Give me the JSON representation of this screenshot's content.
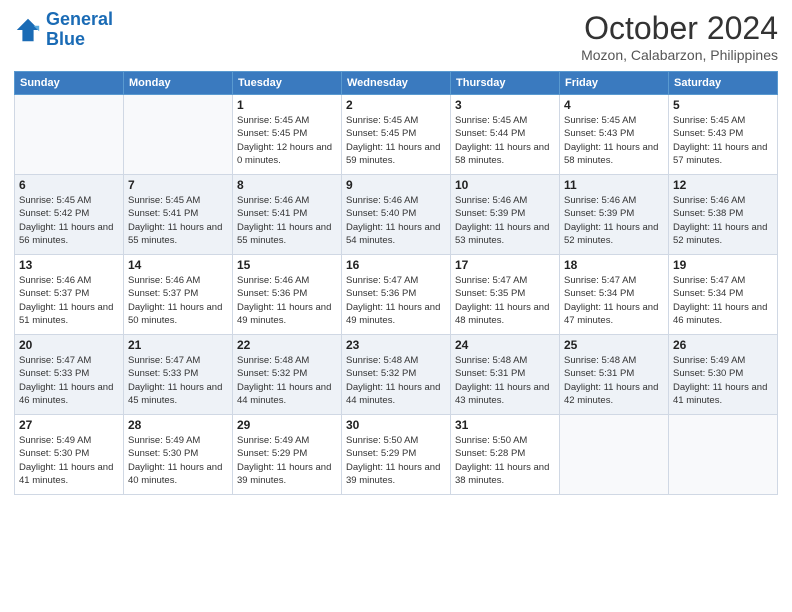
{
  "logo": {
    "line1": "General",
    "line2": "Blue"
  },
  "title": "October 2024",
  "subtitle": "Mozon, Calabarzon, Philippines",
  "days_of_week": [
    "Sunday",
    "Monday",
    "Tuesday",
    "Wednesday",
    "Thursday",
    "Friday",
    "Saturday"
  ],
  "weeks": [
    [
      {
        "day": "",
        "info": ""
      },
      {
        "day": "",
        "info": ""
      },
      {
        "day": "1",
        "info": "Sunrise: 5:45 AM\nSunset: 5:45 PM\nDaylight: 12 hours and 0 minutes."
      },
      {
        "day": "2",
        "info": "Sunrise: 5:45 AM\nSunset: 5:45 PM\nDaylight: 11 hours and 59 minutes."
      },
      {
        "day": "3",
        "info": "Sunrise: 5:45 AM\nSunset: 5:44 PM\nDaylight: 11 hours and 58 minutes."
      },
      {
        "day": "4",
        "info": "Sunrise: 5:45 AM\nSunset: 5:43 PM\nDaylight: 11 hours and 58 minutes."
      },
      {
        "day": "5",
        "info": "Sunrise: 5:45 AM\nSunset: 5:43 PM\nDaylight: 11 hours and 57 minutes."
      }
    ],
    [
      {
        "day": "6",
        "info": "Sunrise: 5:45 AM\nSunset: 5:42 PM\nDaylight: 11 hours and 56 minutes."
      },
      {
        "day": "7",
        "info": "Sunrise: 5:45 AM\nSunset: 5:41 PM\nDaylight: 11 hours and 55 minutes."
      },
      {
        "day": "8",
        "info": "Sunrise: 5:46 AM\nSunset: 5:41 PM\nDaylight: 11 hours and 55 minutes."
      },
      {
        "day": "9",
        "info": "Sunrise: 5:46 AM\nSunset: 5:40 PM\nDaylight: 11 hours and 54 minutes."
      },
      {
        "day": "10",
        "info": "Sunrise: 5:46 AM\nSunset: 5:39 PM\nDaylight: 11 hours and 53 minutes."
      },
      {
        "day": "11",
        "info": "Sunrise: 5:46 AM\nSunset: 5:39 PM\nDaylight: 11 hours and 52 minutes."
      },
      {
        "day": "12",
        "info": "Sunrise: 5:46 AM\nSunset: 5:38 PM\nDaylight: 11 hours and 52 minutes."
      }
    ],
    [
      {
        "day": "13",
        "info": "Sunrise: 5:46 AM\nSunset: 5:37 PM\nDaylight: 11 hours and 51 minutes."
      },
      {
        "day": "14",
        "info": "Sunrise: 5:46 AM\nSunset: 5:37 PM\nDaylight: 11 hours and 50 minutes."
      },
      {
        "day": "15",
        "info": "Sunrise: 5:46 AM\nSunset: 5:36 PM\nDaylight: 11 hours and 49 minutes."
      },
      {
        "day": "16",
        "info": "Sunrise: 5:47 AM\nSunset: 5:36 PM\nDaylight: 11 hours and 49 minutes."
      },
      {
        "day": "17",
        "info": "Sunrise: 5:47 AM\nSunset: 5:35 PM\nDaylight: 11 hours and 48 minutes."
      },
      {
        "day": "18",
        "info": "Sunrise: 5:47 AM\nSunset: 5:34 PM\nDaylight: 11 hours and 47 minutes."
      },
      {
        "day": "19",
        "info": "Sunrise: 5:47 AM\nSunset: 5:34 PM\nDaylight: 11 hours and 46 minutes."
      }
    ],
    [
      {
        "day": "20",
        "info": "Sunrise: 5:47 AM\nSunset: 5:33 PM\nDaylight: 11 hours and 46 minutes."
      },
      {
        "day": "21",
        "info": "Sunrise: 5:47 AM\nSunset: 5:33 PM\nDaylight: 11 hours and 45 minutes."
      },
      {
        "day": "22",
        "info": "Sunrise: 5:48 AM\nSunset: 5:32 PM\nDaylight: 11 hours and 44 minutes."
      },
      {
        "day": "23",
        "info": "Sunrise: 5:48 AM\nSunset: 5:32 PM\nDaylight: 11 hours and 44 minutes."
      },
      {
        "day": "24",
        "info": "Sunrise: 5:48 AM\nSunset: 5:31 PM\nDaylight: 11 hours and 43 minutes."
      },
      {
        "day": "25",
        "info": "Sunrise: 5:48 AM\nSunset: 5:31 PM\nDaylight: 11 hours and 42 minutes."
      },
      {
        "day": "26",
        "info": "Sunrise: 5:49 AM\nSunset: 5:30 PM\nDaylight: 11 hours and 41 minutes."
      }
    ],
    [
      {
        "day": "27",
        "info": "Sunrise: 5:49 AM\nSunset: 5:30 PM\nDaylight: 11 hours and 41 minutes."
      },
      {
        "day": "28",
        "info": "Sunrise: 5:49 AM\nSunset: 5:30 PM\nDaylight: 11 hours and 40 minutes."
      },
      {
        "day": "29",
        "info": "Sunrise: 5:49 AM\nSunset: 5:29 PM\nDaylight: 11 hours and 39 minutes."
      },
      {
        "day": "30",
        "info": "Sunrise: 5:50 AM\nSunset: 5:29 PM\nDaylight: 11 hours and 39 minutes."
      },
      {
        "day": "31",
        "info": "Sunrise: 5:50 AM\nSunset: 5:28 PM\nDaylight: 11 hours and 38 minutes."
      },
      {
        "day": "",
        "info": ""
      },
      {
        "day": "",
        "info": ""
      }
    ]
  ]
}
